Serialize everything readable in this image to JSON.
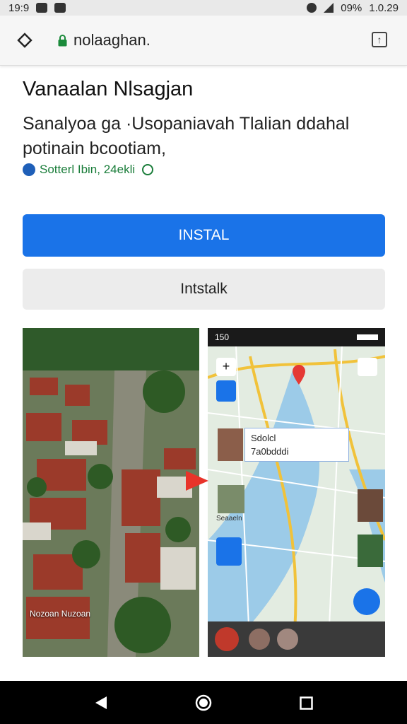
{
  "status_bar": {
    "time": "19:9",
    "battery": "09%",
    "clock": "1.0.29"
  },
  "browser": {
    "url": "nolaaghan."
  },
  "app": {
    "title": "Vanaalan Nlsagjan",
    "description": "Sanalyoa ga ·Usopaniavah Tlalian ddahal potinain bcootiam,",
    "meta": "Sotterl Ibin, 24ekli"
  },
  "buttons": {
    "primary": "INSTAL",
    "secondary": "Intstalk"
  },
  "screenshots": {
    "left_caption": "Nozoan Nuzoan",
    "right_status_time": "150",
    "card_line1": "Sdolcl",
    "card_line2": "7a0bdddi",
    "thumb_caption": "Seaaeln"
  },
  "colors": {
    "accent": "#1a73e8",
    "meta_green": "#1a7d3a",
    "arrow": "#e8332a"
  },
  "icons": [
    "home-icon",
    "lock-icon",
    "tabs-icon",
    "back-icon",
    "home-circle-icon",
    "recents-icon"
  ]
}
